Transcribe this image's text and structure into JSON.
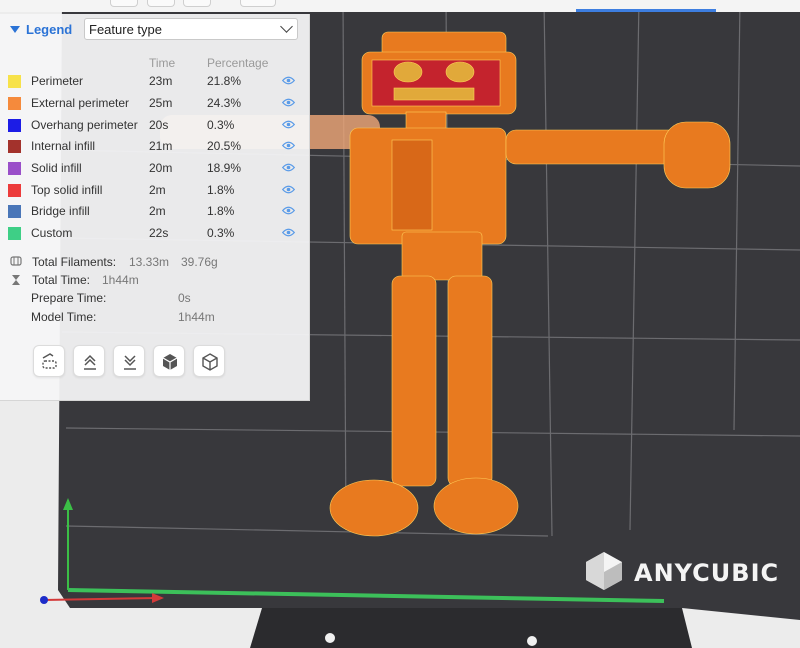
{
  "legend": {
    "title": "Legend",
    "view_mode": "Feature type",
    "columns": {
      "time": "Time",
      "percentage": "Percentage"
    },
    "features": [
      {
        "name": "Perimeter",
        "time": "23m",
        "percent": "21.8%",
        "color": "#f7e24a"
      },
      {
        "name": "External perimeter",
        "time": "25m",
        "percent": "24.3%",
        "color": "#f58a3c"
      },
      {
        "name": "Overhang perimeter",
        "time": "20s",
        "percent": "0.3%",
        "color": "#1c1ce6"
      },
      {
        "name": "Internal infill",
        "time": "21m",
        "percent": "20.5%",
        "color": "#a3322c"
      },
      {
        "name": "Solid infill",
        "time": "20m",
        "percent": "18.9%",
        "color": "#9a4fc9"
      },
      {
        "name": "Top solid infill",
        "time": "2m",
        "percent": "1.8%",
        "color": "#ec3b3b"
      },
      {
        "name": "Bridge infill",
        "time": "2m",
        "percent": "1.8%",
        "color": "#4a76b8"
      },
      {
        "name": "Custom",
        "time": "22s",
        "percent": "0.3%",
        "color": "#3ecf86"
      }
    ],
    "stats": {
      "filament_label": "Total Filaments:",
      "filament_length": "13.33m",
      "filament_weight": "39.76g",
      "total_time_label": "Total Time:",
      "total_time": "1h44m",
      "prepare_label": "Prepare Time:",
      "prepare_time": "0s",
      "model_label": "Model Time:",
      "model_time": "1h44m"
    },
    "tool_icons": [
      "layer-view-icon",
      "collapse-up-icon",
      "collapse-down-icon",
      "solid-cube-icon",
      "outline-cube-icon"
    ]
  },
  "brand": {
    "name": "ANYCUBIC"
  },
  "colors": {
    "accent": "#2b73d6",
    "bed": "#3a3a3d",
    "model": "#e8781e"
  }
}
